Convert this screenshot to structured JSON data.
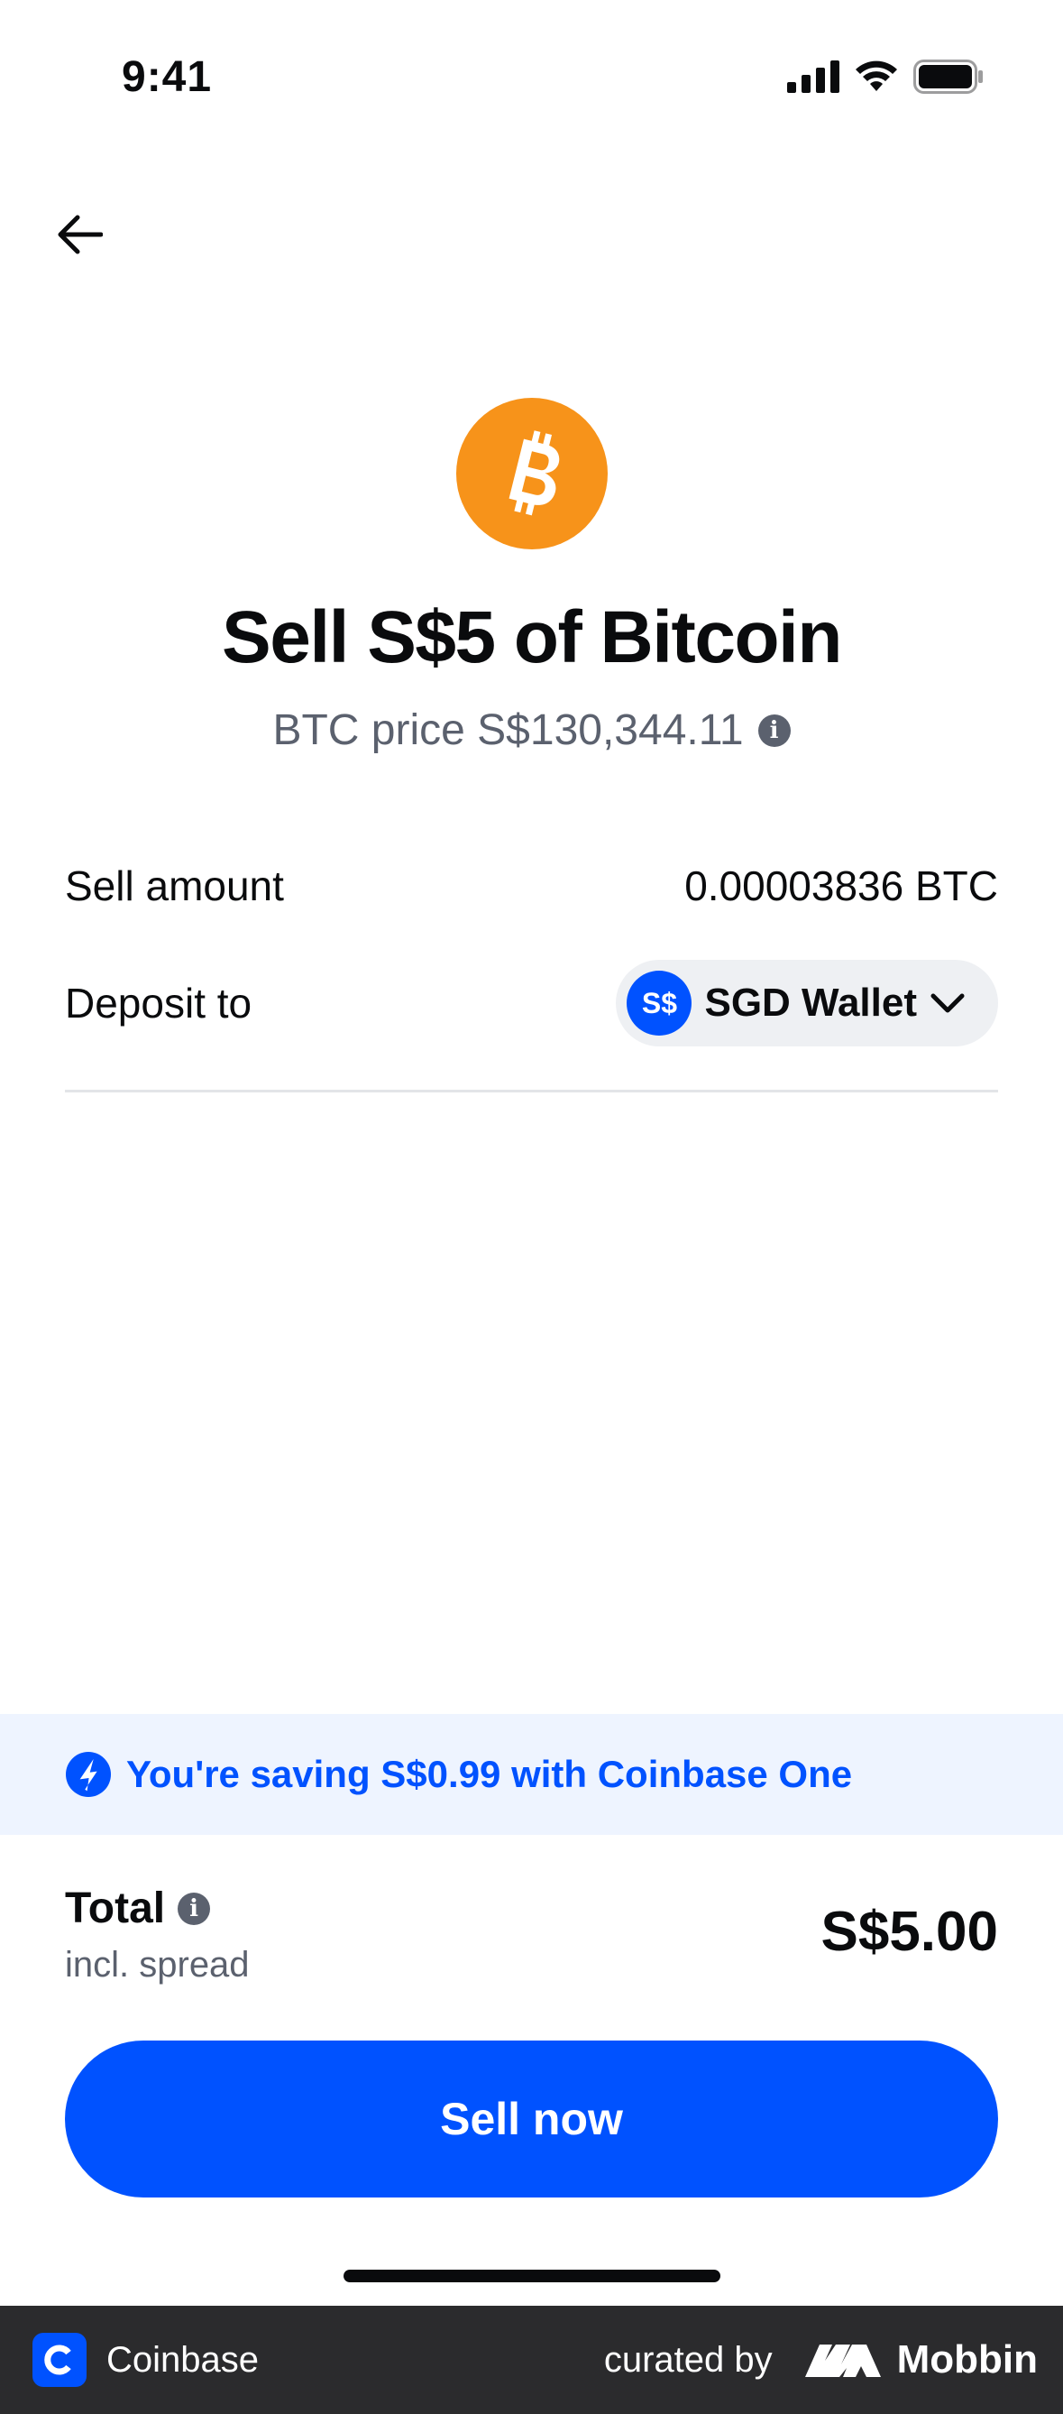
{
  "status_bar": {
    "time": "9:41"
  },
  "header": {
    "back_icon": "arrow-left-icon"
  },
  "asset": {
    "icon": "bitcoin-icon",
    "color": "#f7931a"
  },
  "title": "Sell S$5 of Bitcoin",
  "price": {
    "text": "BTC price S$130,344.11",
    "info_icon": "info-icon"
  },
  "details": {
    "sell_amount_label": "Sell amount",
    "sell_amount_value": "0.00003836 BTC",
    "deposit_label": "Deposit to",
    "wallet_badge": "S$",
    "wallet_name": "SGD Wallet",
    "wallet_chevron": "chevron-down-icon"
  },
  "promo": {
    "icon": "coinbase-one-icon",
    "text": "You're saving S$0.99 with Coinbase One"
  },
  "total": {
    "label": "Total",
    "sublabel": "incl. spread",
    "value": "S$5.00"
  },
  "cta": {
    "label": "Sell now"
  },
  "footer": {
    "app_name": "Coinbase",
    "curated_by": "curated by",
    "brand": "Mobbin"
  },
  "colors": {
    "accent": "#0052ff",
    "promo_bg": "#eef4ff",
    "muted_text": "#5b616e"
  }
}
